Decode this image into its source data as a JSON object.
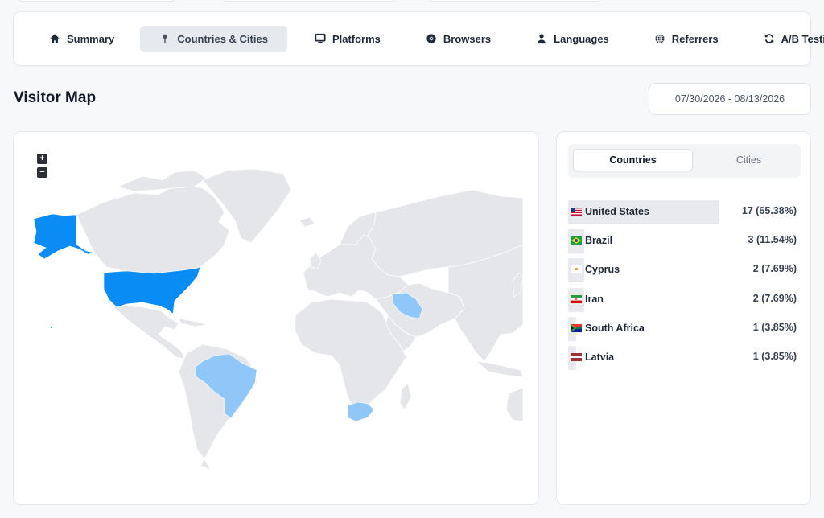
{
  "tabs": [
    {
      "label": "Summary",
      "icon": "home-icon"
    },
    {
      "label": "Countries & Cities",
      "icon": "map-pin-icon",
      "active": true
    },
    {
      "label": "Platforms",
      "icon": "monitor-icon"
    },
    {
      "label": "Browsers",
      "icon": "chrome-icon"
    },
    {
      "label": "Languages",
      "icon": "user-icon"
    },
    {
      "label": "Referrers",
      "icon": "globe-icon"
    },
    {
      "label": "A/B Testing",
      "icon": "refresh-icon"
    }
  ],
  "page": {
    "title": "Visitor Map",
    "date_range": "07/30/2026 - 08/13/2026"
  },
  "map": {
    "zoom_in": "+",
    "zoom_out": "−",
    "colors": {
      "land": "#e4e6e9",
      "high": "#0a8cf5",
      "low": "#8fc8f8"
    }
  },
  "segment": {
    "countries": "Countries",
    "cities": "Cities"
  },
  "countries": [
    {
      "name": "United States",
      "value": "17 (65.38%)",
      "share": 0.6538,
      "flag": "us"
    },
    {
      "name": "Brazil",
      "value": "3 (11.54%)",
      "share": 0.1154,
      "flag": "br"
    },
    {
      "name": "Cyprus",
      "value": "2 (7.69%)",
      "share": 0.0769,
      "flag": "cy"
    },
    {
      "name": "Iran",
      "value": "2 (7.69%)",
      "share": 0.0769,
      "flag": "ir"
    },
    {
      "name": "South Africa",
      "value": "1 (3.85%)",
      "share": 0.0385,
      "flag": "za"
    },
    {
      "name": "Latvia",
      "value": "1 (3.85%)",
      "share": 0.0385,
      "flag": "lv"
    }
  ]
}
